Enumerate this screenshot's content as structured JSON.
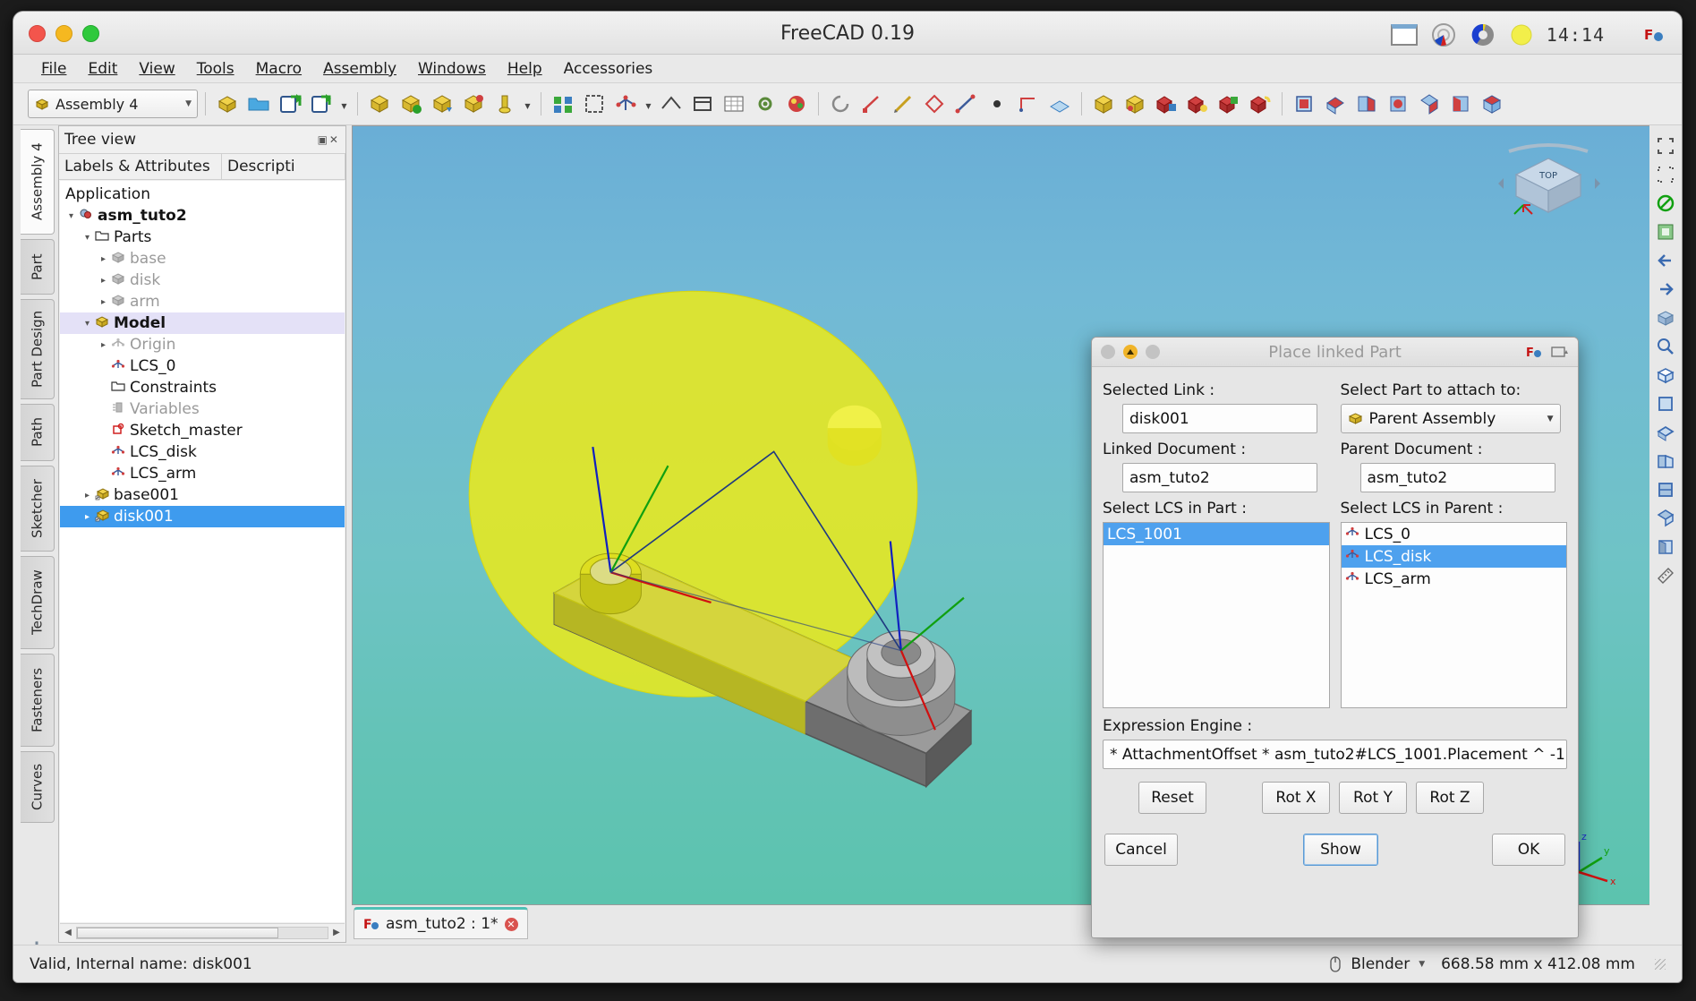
{
  "window": {
    "title": "FreeCAD 0.19",
    "tray": {
      "clock": "14:14"
    }
  },
  "menu": {
    "items": [
      {
        "label": "File"
      },
      {
        "label": "Edit"
      },
      {
        "label": "View"
      },
      {
        "label": "Tools"
      },
      {
        "label": "Macro"
      },
      {
        "label": "Assembly"
      },
      {
        "label": "Windows"
      },
      {
        "label": "Help"
      },
      {
        "label": "Accessories"
      }
    ]
  },
  "toolbar": {
    "workbench": "Assembly 4"
  },
  "workbench_tabs": [
    {
      "label": "Assembly 4",
      "active": true
    },
    {
      "label": "Part",
      "active": false
    },
    {
      "label": "Part Design",
      "active": false
    },
    {
      "label": "Path",
      "active": false
    },
    {
      "label": "Sketcher",
      "active": false
    },
    {
      "label": "TechDraw",
      "active": false
    },
    {
      "label": "Fasteners",
      "active": false
    },
    {
      "label": "Curves",
      "active": false
    }
  ],
  "tree_panel": {
    "header": "Tree view",
    "columns": [
      "Labels & Attributes",
      "Descripti"
    ],
    "rows": [
      {
        "label": "Application",
        "indent": 0,
        "twisty": "",
        "icon": "",
        "state": "normal"
      },
      {
        "label": "asm_tuto2",
        "indent": 1,
        "twisty": "▾",
        "icon": "document-icon",
        "state": "bold"
      },
      {
        "label": "Parts",
        "indent": 2,
        "twisty": "▾",
        "icon": "folder-icon",
        "state": "normal"
      },
      {
        "label": "base",
        "indent": 3,
        "twisty": "▸",
        "icon": "part-icon",
        "state": "dim"
      },
      {
        "label": "disk",
        "indent": 3,
        "twisty": "▸",
        "icon": "part-icon",
        "state": "dim"
      },
      {
        "label": "arm",
        "indent": 3,
        "twisty": "▸",
        "icon": "part-icon",
        "state": "dim"
      },
      {
        "label": "Model",
        "indent": 2,
        "twisty": "▾",
        "icon": "part-yellow-icon",
        "state": "selected-lilac"
      },
      {
        "label": "Origin",
        "indent": 3,
        "twisty": "▸",
        "icon": "lcs-icon",
        "state": "dim"
      },
      {
        "label": "LCS_0",
        "indent": 3,
        "twisty": "",
        "icon": "lcs-icon",
        "state": "normal"
      },
      {
        "label": "Constraints",
        "indent": 3,
        "twisty": "",
        "icon": "folder-icon",
        "state": "normal"
      },
      {
        "label": "Variables",
        "indent": 3,
        "twisty": "",
        "icon": "variables-icon",
        "state": "dim"
      },
      {
        "label": "Sketch_master",
        "indent": 3,
        "twisty": "",
        "icon": "sketch-icon",
        "state": "normal"
      },
      {
        "label": "LCS_disk",
        "indent": 3,
        "twisty": "",
        "icon": "lcs-icon",
        "state": "normal"
      },
      {
        "label": "LCS_arm",
        "indent": 3,
        "twisty": "",
        "icon": "lcs-icon",
        "state": "normal"
      },
      {
        "label": "base001",
        "indent": 2,
        "twisty": "▸",
        "icon": "link-part-icon",
        "state": "normal"
      },
      {
        "label": "disk001",
        "indent": 2,
        "twisty": "▸",
        "icon": "link-part-icon",
        "state": "selected-blue"
      }
    ]
  },
  "dialog": {
    "title": "Place linked Part",
    "left": {
      "selected_link_label": "Selected Link :",
      "selected_link_value": "disk001",
      "linked_document_label": "Linked Document :",
      "linked_document_value": "asm_tuto2",
      "lcs_label": "Select LCS in Part :",
      "lcs_items": [
        {
          "label": "LCS_1001",
          "selected": true,
          "icon": false
        }
      ]
    },
    "right": {
      "part_label": "Select Part to attach to:",
      "part_value": "Parent Assembly",
      "parent_document_label": "Parent Document :",
      "parent_document_value": "asm_tuto2",
      "lcs_label": "Select LCS in Parent :",
      "lcs_items": [
        {
          "label": "LCS_0",
          "selected": false,
          "icon": true
        },
        {
          "label": "LCS_disk",
          "selected": true,
          "icon": true
        },
        {
          "label": "LCS_arm",
          "selected": false,
          "icon": true
        }
      ]
    },
    "expression_label": "Expression Engine :",
    "expression_value": "* AttachmentOffset * asm_tuto2#LCS_1001.Placement ^ -1",
    "rot_buttons": [
      {
        "label": "Reset"
      },
      {
        "label": "Rot X"
      },
      {
        "label": "Rot Y"
      },
      {
        "label": "Rot Z"
      }
    ],
    "action_buttons": {
      "cancel": "Cancel",
      "show": "Show",
      "ok": "OK"
    }
  },
  "doc_tab": {
    "label": "asm_tuto2 : 1*"
  },
  "statusbar": {
    "message": "Valid, Internal name: disk001",
    "nav_style": "Blender",
    "dimensions": "668.58 mm x 412.08 mm"
  },
  "colors": {
    "accent_blue": "#3e9bee",
    "select_lilac": "#e4e1f7",
    "tab_teal": "#4fc0b5",
    "disk_yellow": "#e8e81e"
  }
}
